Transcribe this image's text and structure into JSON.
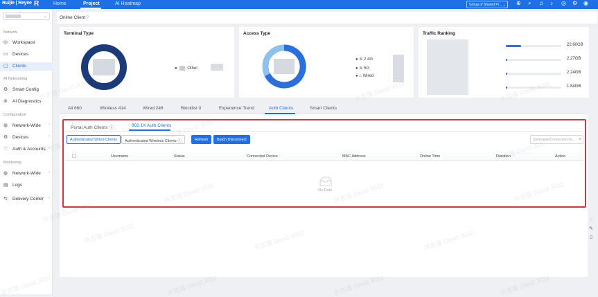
{
  "topbar": {
    "logo": "Ruijie | Reyee",
    "nav": [
      "Home",
      "Project",
      "AI Heatmap"
    ],
    "active_nav": "Project",
    "group_select": "Group of Shared Pr..."
  },
  "sidebar": {
    "sections": [
      {
        "title": "Network",
        "items": [
          {
            "label": "Workspace",
            "icon": "workspace-icon",
            "caret": false
          },
          {
            "label": "Devices",
            "icon": "devices-icon",
            "caret": false
          },
          {
            "label": "Clients",
            "icon": "clients-icon",
            "caret": false,
            "active": true
          }
        ]
      },
      {
        "title": "AI Networking",
        "items": [
          {
            "label": "Smart Config",
            "icon": "smart-config-icon",
            "caret": false
          },
          {
            "label": "AI Diagnostics",
            "icon": "ai-diagnostics-icon",
            "caret": false
          }
        ]
      },
      {
        "title": "Configuration",
        "items": [
          {
            "label": "Network-Wide",
            "icon": "network-wide-icon",
            "caret": true
          },
          {
            "label": "Devices",
            "icon": "devices-config-icon",
            "caret": true
          },
          {
            "label": "Auth & Accounts",
            "icon": "auth-accounts-icon",
            "caret": true
          }
        ]
      },
      {
        "title": "Monitoring",
        "items": [
          {
            "label": "Network-Wide",
            "icon": "monitor-network-icon",
            "caret": true
          },
          {
            "label": "Logs",
            "icon": "logs-icon",
            "caret": false
          },
          {
            "label": "Delivery Center",
            "icon": "delivery-center-icon",
            "caret": true
          }
        ]
      }
    ]
  },
  "header": {
    "title": "Online Client"
  },
  "cards": {
    "terminal_type": {
      "title": "Terminal Type",
      "legend": [
        "Other"
      ]
    },
    "access_type": {
      "title": "Access Type",
      "legend": [
        "2.4G",
        "5G",
        "Wired"
      ]
    },
    "traffic_ranking": {
      "title": "Traffic Ranking",
      "rows": [
        {
          "value": "22.60GB",
          "fraction": 0.28
        },
        {
          "value": "2.27GB",
          "fraction": 0.03
        },
        {
          "value": "2.24GB",
          "fraction": 0.03
        },
        {
          "value": "1.84GB",
          "fraction": 0.025
        }
      ]
    }
  },
  "tabs": [
    "All  660",
    "Wireless  414",
    "Wired  246",
    "Blocklist  0",
    "Experience Trend",
    "Auth Clients",
    "Smart Clients"
  ],
  "active_tab": "Auth Clients",
  "subtabs": {
    "portal": "Portal Auth Clients",
    "dot1x": "802.1X Auth Clients"
  },
  "toolbar": {
    "wired": "Authenticated Wired Clients",
    "wireless": "Authenticated Wireless Clients",
    "refresh": "Refresh",
    "batch": "Batch Disconnect",
    "search_placeholder": "Username/Connected De..."
  },
  "table": {
    "columns": [
      "Username",
      "Status",
      "Connected Device",
      "MAC Address",
      "Online Time",
      "Duration",
      "Action"
    ],
    "empty_text": "No Data"
  },
  "watermark": "许志强 David 3032",
  "colors": {
    "accent": "#1f6fe5",
    "highlight": "#d8343d"
  }
}
